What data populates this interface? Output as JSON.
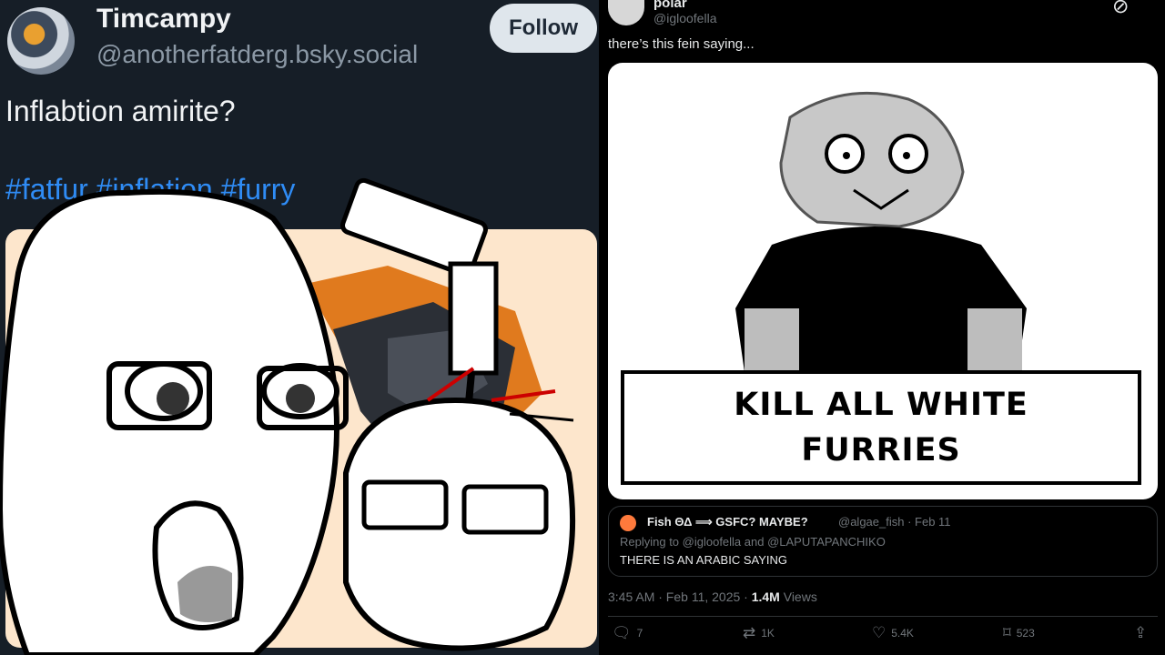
{
  "left_post": {
    "display_name": "Timcampy",
    "handle": "@anotherfatderg.bsky.social",
    "follow_label": "Follow",
    "text": "Inflabtion amirite?",
    "tags": "#fatfur #inflation #furry"
  },
  "right_post": {
    "display_name": "polar",
    "handle": "@igloofella",
    "text": "there’s this fein saying...",
    "sign_line1": "KILL ALL WHITE",
    "sign_line2": "FURRIES",
    "quote": {
      "name": "Fish ΘΔ ⟹ GSFC? MAYBE?",
      "handle_date": "@algae_fish · Feb 11",
      "replying": "Replying to @igloofella and @LAPUTAPANCHIKO",
      "text": "THERE IS AN ARABIC SAYING"
    },
    "timestamp": "3:45 AM · Feb 11, 2025 · ",
    "views_count": "1.4M",
    "views_label": " Views",
    "actions": {
      "replies": "7",
      "reposts": "1K",
      "likes": "5.4K",
      "bookmarks": "523"
    }
  }
}
